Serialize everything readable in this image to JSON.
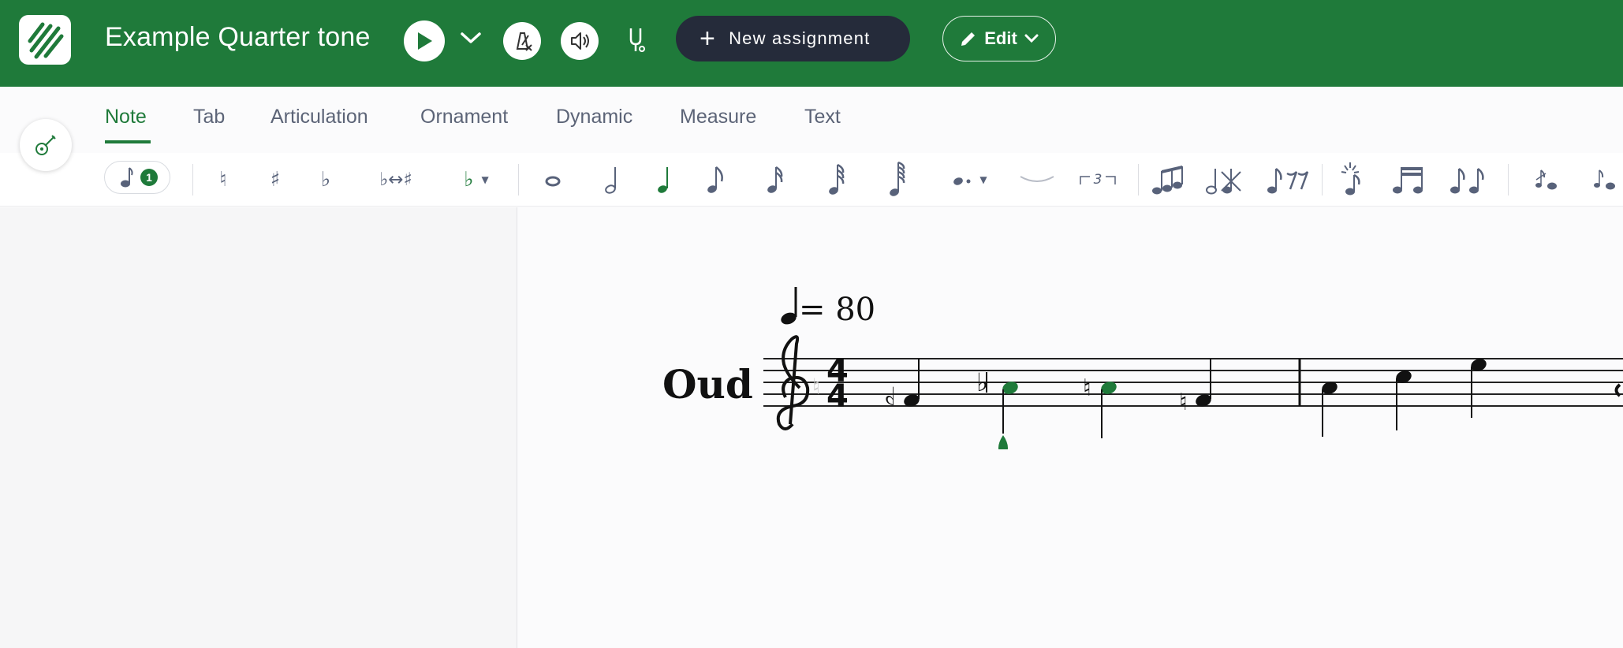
{
  "header": {
    "title": "Example Quarter tone",
    "assignment_label": "New assignment",
    "edit_label": "Edit",
    "brand_color": "#1f7a3a",
    "icons": [
      "logo-icon",
      "play-icon",
      "chevron-down-icon",
      "metronome-off-icon",
      "speaker-icon",
      "tuning-fork-icon",
      "plus-icon",
      "pencil-icon"
    ]
  },
  "tabs": [
    {
      "label": "Note",
      "active": true
    },
    {
      "label": "Tab",
      "active": false
    },
    {
      "label": "Articulation",
      "active": false
    },
    {
      "label": "Ornament",
      "active": false
    },
    {
      "label": "Dynamic",
      "active": false
    },
    {
      "label": "Measure",
      "active": false
    },
    {
      "label": "Text",
      "active": false
    }
  ],
  "toolbar": {
    "voice_count": "1",
    "flip_label": "♭↔♯",
    "tuplet_label": "3"
  },
  "score": {
    "instrument": "Oud",
    "tempo": "= 80",
    "time_signature": {
      "top": "4",
      "bottom": "4"
    },
    "clef": "treble"
  }
}
